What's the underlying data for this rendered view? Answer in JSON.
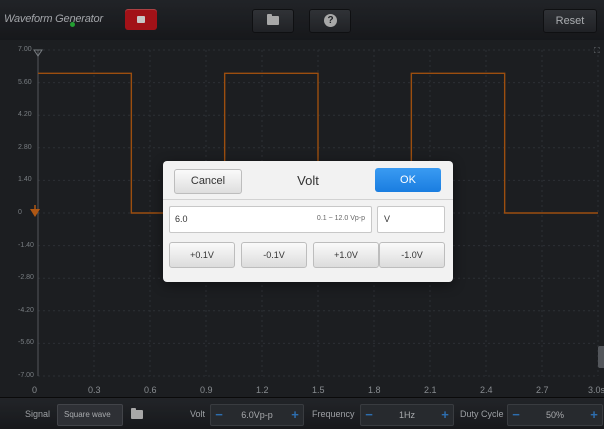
{
  "toolbar": {
    "title": "Waveform Generator",
    "reset_label": "Reset",
    "stop_icon": "stop-icon",
    "folder_icon": "folder-icon",
    "help_icon": "help-icon",
    "help_glyph": "?"
  },
  "plot": {
    "y_ticks": [
      "7.00",
      "5.60",
      "4.20",
      "2.80",
      "1.40",
      "0",
      "-1.40",
      "-2.80",
      "-4.20",
      "-5.60",
      "-7.00"
    ],
    "x_ticks": [
      "0",
      "0.3",
      "0.6",
      "0.9",
      "1.2",
      "1.5",
      "1.8",
      "2.1",
      "2.4",
      "2.7",
      "3.0s"
    ],
    "waveform_color": "#c86414",
    "marker_color": "#e0701a",
    "waveform": {
      "type": "square",
      "amplitude_v": 6.0,
      "frequency_hz": 1,
      "duty_cycle_percent": 50,
      "high_level_v": 6.0,
      "low_level_v": 0
    }
  },
  "dialog": {
    "cancel_label": "Cancel",
    "title": "Volt",
    "ok_label": "OK",
    "input_value": "6.0",
    "input_range": "0.1 ~ 12.0 Vp-p",
    "unit": "V",
    "steps": [
      "+0.1V",
      "-0.1V",
      "+1.0V",
      "-1.0V"
    ],
    "ok_color": "#1f84e6"
  },
  "bottom": {
    "signal_label": "Signal",
    "signal_value": "Square wave",
    "volt_label": "Volt",
    "volt_value": "6.0Vp-p",
    "frequency_label": "Frequency",
    "frequency_value": "1Hz",
    "duty_label": "Duty Cycle",
    "duty_value": "50%",
    "minus": "−",
    "plus": "+",
    "accent_color": "#3a8de0"
  }
}
